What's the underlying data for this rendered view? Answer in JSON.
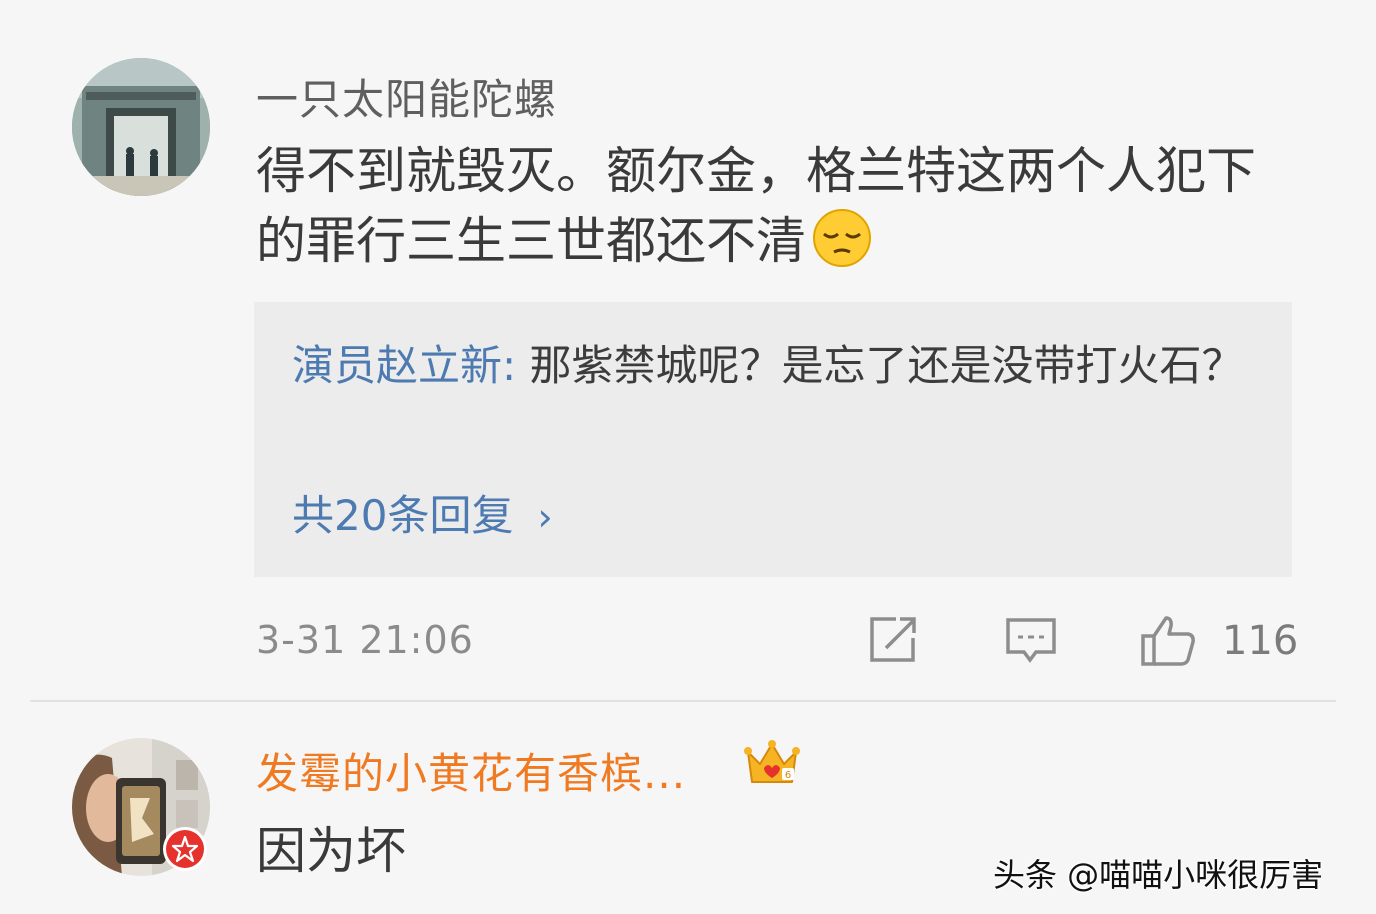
{
  "comments": [
    {
      "username": "一只太阳能陀螺",
      "text": "得不到就毁灭。额尔金，格兰特这两个人犯下的罪行三生三世都还不清",
      "emoji": "pensive-face",
      "reply": {
        "author": "演员赵立新",
        "separator": ":",
        "text": " 那紫禁城呢？是忘了还是没带打火石？",
        "count_label": "共20条回复",
        "chevron": "›"
      },
      "timestamp": "3-31 21:06",
      "likes": "116"
    },
    {
      "username": "发霉的小黄花有香槟...",
      "text": "因为坏",
      "vip_badge": "crown-icon"
    }
  ],
  "watermark": "头条 @喵喵小咪很厉害",
  "colors": {
    "background": "#f6f6f6",
    "reply_background": "#ececec",
    "link_blue": "#4d7ab0",
    "vip_orange": "#f07a22",
    "badge_red": "#e5322d"
  }
}
